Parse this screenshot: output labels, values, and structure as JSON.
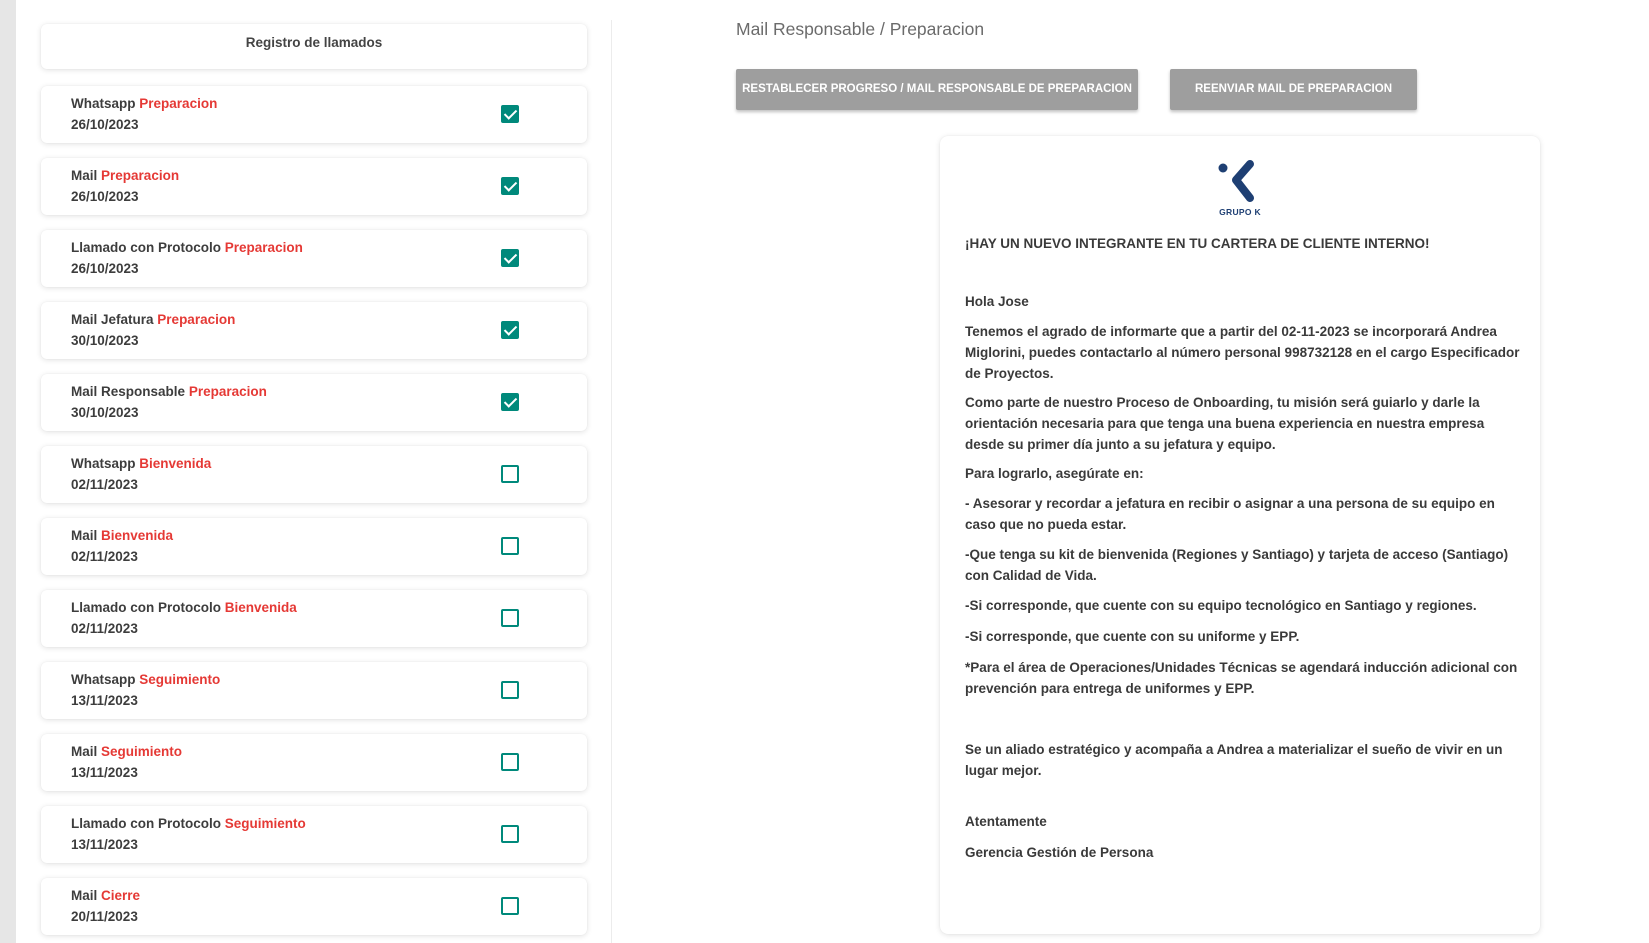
{
  "left": {
    "header": "Registro de llamados",
    "items": [
      {
        "label": "Whatsapp",
        "stage": "Preparacion",
        "date": "26/10/2023",
        "checked": true
      },
      {
        "label": "Mail",
        "stage": "Preparacion",
        "date": "26/10/2023",
        "checked": true
      },
      {
        "label": "Llamado con Protocolo",
        "stage": "Preparacion",
        "date": "26/10/2023",
        "checked": true
      },
      {
        "label": "Mail Jefatura",
        "stage": "Preparacion",
        "date": "30/10/2023",
        "checked": true
      },
      {
        "label": "Mail Responsable",
        "stage": "Preparacion",
        "date": "30/10/2023",
        "checked": true
      },
      {
        "label": "Whatsapp",
        "stage": "Bienvenida",
        "date": "02/11/2023",
        "checked": false
      },
      {
        "label": "Mail",
        "stage": "Bienvenida",
        "date": "02/11/2023",
        "checked": false
      },
      {
        "label": "Llamado con Protocolo",
        "stage": "Bienvenida",
        "date": "02/11/2023",
        "checked": false
      },
      {
        "label": "Whatsapp",
        "stage": "Seguimiento",
        "date": "13/11/2023",
        "checked": false
      },
      {
        "label": "Mail",
        "stage": "Seguimiento",
        "date": "13/11/2023",
        "checked": false
      },
      {
        "label": "Llamado con Protocolo",
        "stage": "Seguimiento",
        "date": "13/11/2023",
        "checked": false
      },
      {
        "label": "Mail",
        "stage": "Cierre",
        "date": "20/11/2023",
        "checked": false
      }
    ]
  },
  "right": {
    "title": "Mail Responsable / Preparacion",
    "buttons": {
      "reset": "RESTABLECER PROGRESO / MAIL RESPONSABLE DE PREPARACION",
      "resend": "REENVIAR MAIL DE PREPARACION"
    },
    "mail": {
      "logo_text": "GRUPO K",
      "heading": "¡HAY UN NUEVO INTEGRANTE EN TU CARTERA DE CLIENTE INTERNO!",
      "greeting": "Hola Jose",
      "p1": "Tenemos el agrado de informarte que a partir del 02-11-2023 se incorporará Andrea Miglorini, puedes contactarlo al número personal 998732128  en el cargo Especificador de Proyectos.",
      "p2": "Como parte de nuestro Proceso de Onboarding, tu misión será guiarlo y darle la orientación necesaria para que tenga una buena experiencia en nuestra empresa desde su primer día junto a su jefatura y equipo.",
      "p3": "Para lograrlo, asegúrate en:",
      "p4": "-     Asesorar y recordar a jefatura en recibir o asignar a una persona de su equipo en caso que no pueda estar.",
      "p5": "-Que tenga su kit de bienvenida (Regiones y Santiago) y tarjeta de acceso (Santiago) con Calidad de Vida.",
      "p6": "-Si corresponde, que cuente con su equipo tecnológico en Santiago y regiones.",
      "p7": "-Si corresponde, que cuente con su uniforme y EPP.",
      "p8": "*Para el área de Operaciones/Unidades Técnicas se agendará inducción adicional con prevención para entrega de uniformes y EPP.",
      "p9": "Se un aliado estratégico y acompaña a Andrea a materializar el sueño de vivir en un lugar mejor.",
      "closing": "Atentamente",
      "signature": "Gerencia Gestión de Persona"
    }
  },
  "colors": {
    "stage": "#e53935",
    "checkbox": "#00897b",
    "button_bg": "#9e9e9e",
    "logo": "#1e3f73"
  }
}
